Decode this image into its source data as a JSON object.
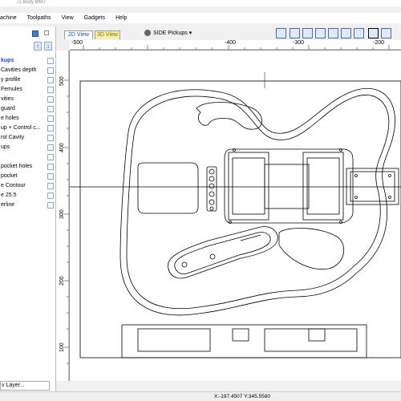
{
  "window": {
    "title": "72 Body MMJ"
  },
  "menubar": {
    "items": [
      "achine",
      "Toolpaths",
      "View",
      "Gadgets",
      "Help"
    ]
  },
  "layers": {
    "items": [
      "kups",
      "Cavities depth",
      "y profile",
      "Femules",
      "vities",
      "guard",
      "e holes",
      "up + Control c...",
      "rol Cavity",
      "ups",
      "",
      "pocket holes",
      "pocket",
      "e Contour",
      "e 25.5",
      "erline"
    ],
    "add_layer_placeholder": "v Layer..."
  },
  "tabs": {
    "view_2d": "2D View",
    "view_3d": "3D View",
    "selection": "SIDE Pickups"
  },
  "ruler_top": [
    "-500",
    "-400",
    "-300",
    "-200"
  ],
  "ruler_left": [
    "500",
    "400",
    "300",
    "200",
    "100"
  ],
  "status": {
    "coords": "X:-197.4507 Y:345.5580"
  }
}
